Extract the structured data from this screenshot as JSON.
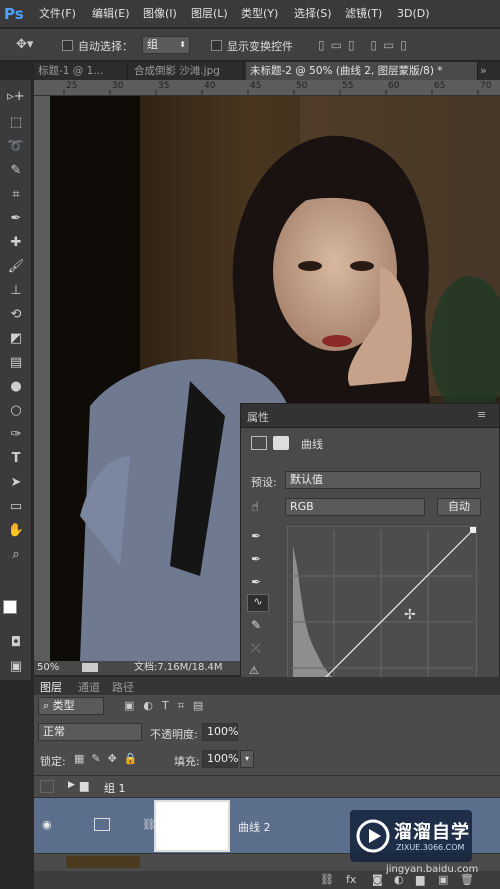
{
  "app": {
    "logo": "Ps"
  },
  "menu": [
    "文件(F)",
    "编辑(E)",
    "图像(I)",
    "图层(L)",
    "类型(Y)",
    "选择(S)",
    "滤镜(T)",
    "3D(D)"
  ],
  "options": {
    "auto_select_label": "自动选择：",
    "auto_select_value": "组",
    "show_transform_label": "显示变换控件"
  },
  "tabs": [
    {
      "label": "标题-1 @ 1..."
    },
    {
      "label": "合成倒影 沙滩.jpg"
    },
    {
      "label": "未标题-2 @ 50% (曲线 2, 图层蒙版/8) *"
    }
  ],
  "ruler_top": [
    "25",
    "30",
    "35",
    "40",
    "45",
    "50",
    "55",
    "60",
    "65",
    "70"
  ],
  "status": {
    "zoom": "50%",
    "doc": "文档:7.16M/18.4M"
  },
  "properties": {
    "title": "属性",
    "panel_name": "曲线",
    "preset_label": "预设:",
    "preset_value": "默认值",
    "channel_value": "RGB",
    "auto_button": "自动"
  },
  "layers_panel": {
    "tabs": [
      "图层",
      "通道",
      "路径"
    ],
    "filter_label": "类型",
    "blend_mode": "正常",
    "opacity_label": "不透明度:",
    "opacity_value": "100%",
    "lock_label": "锁定:",
    "fill_label": "填充:",
    "fill_value": "100%",
    "group_name": "组 1",
    "curves_layer_name": "曲线 2"
  },
  "watermark": {
    "title": "溜溜自学",
    "url": "ZIXUE.3066.COM"
  },
  "footer": {
    "source": "jingyan.baidu.com"
  },
  "colors": {
    "accent": "#4ea1ff",
    "layer_selected": "#5b6f8c"
  }
}
